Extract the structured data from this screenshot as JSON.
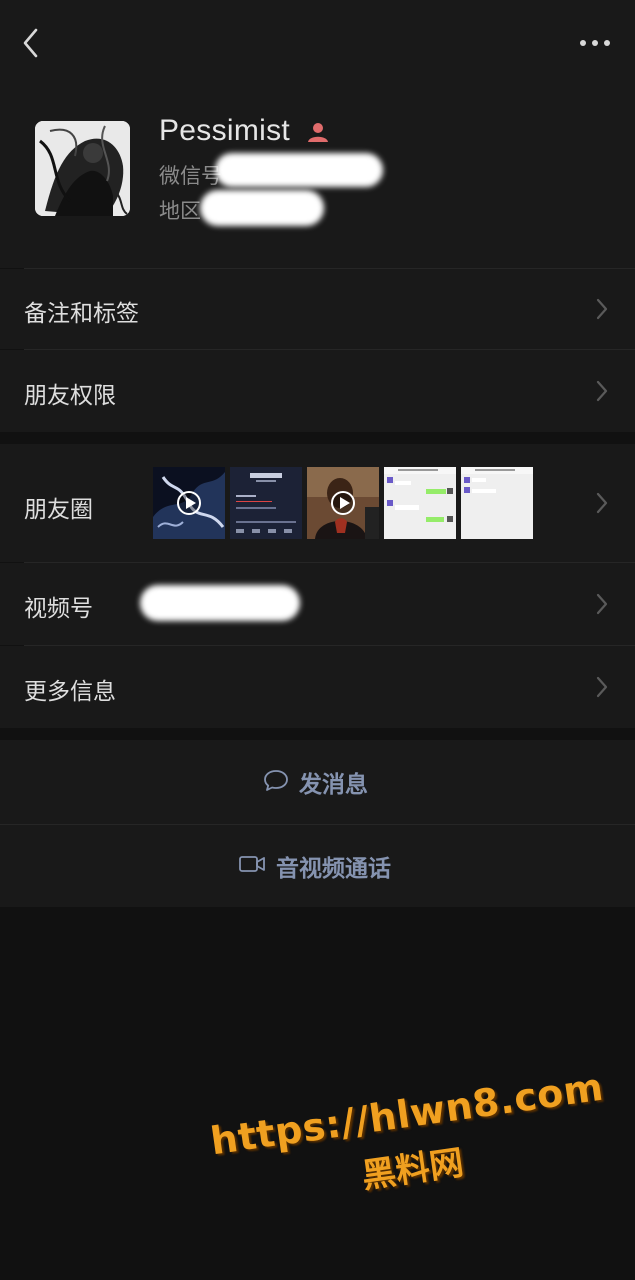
{
  "profile": {
    "nickname": "Pessimist",
    "wechat_id_label": "微信号",
    "region_label": "地区"
  },
  "rows": {
    "remark_tags": "备注和标签",
    "friend_permissions": "朋友权限",
    "moments": "朋友圈",
    "channels": "视频号",
    "more_info": "更多信息"
  },
  "actions": {
    "send_message": "发消息",
    "video_call": "音视频通话"
  },
  "moments_thumbnails": [
    {
      "kind": "video",
      "desc": "dark artwork video"
    },
    {
      "kind": "image",
      "desc": "phone screenshot"
    },
    {
      "kind": "video",
      "desc": "person video"
    },
    {
      "kind": "image",
      "desc": "chat screenshot"
    },
    {
      "kind": "image",
      "desc": "chat screenshot"
    }
  ],
  "watermark": {
    "line1": "https://hlwn8.com",
    "line2": "黑料网"
  },
  "colors": {
    "background": "#111111",
    "panel": "#191919",
    "link_blue": "#8593b0",
    "badge_red": "#e06c6c",
    "watermark_orange": "#f0a020"
  },
  "icons": [
    "back-arrow-icon",
    "more-dots-icon",
    "contact-badge-icon",
    "chevron-right-icon",
    "chat-bubble-icon",
    "video-camera-icon",
    "play-icon"
  ]
}
